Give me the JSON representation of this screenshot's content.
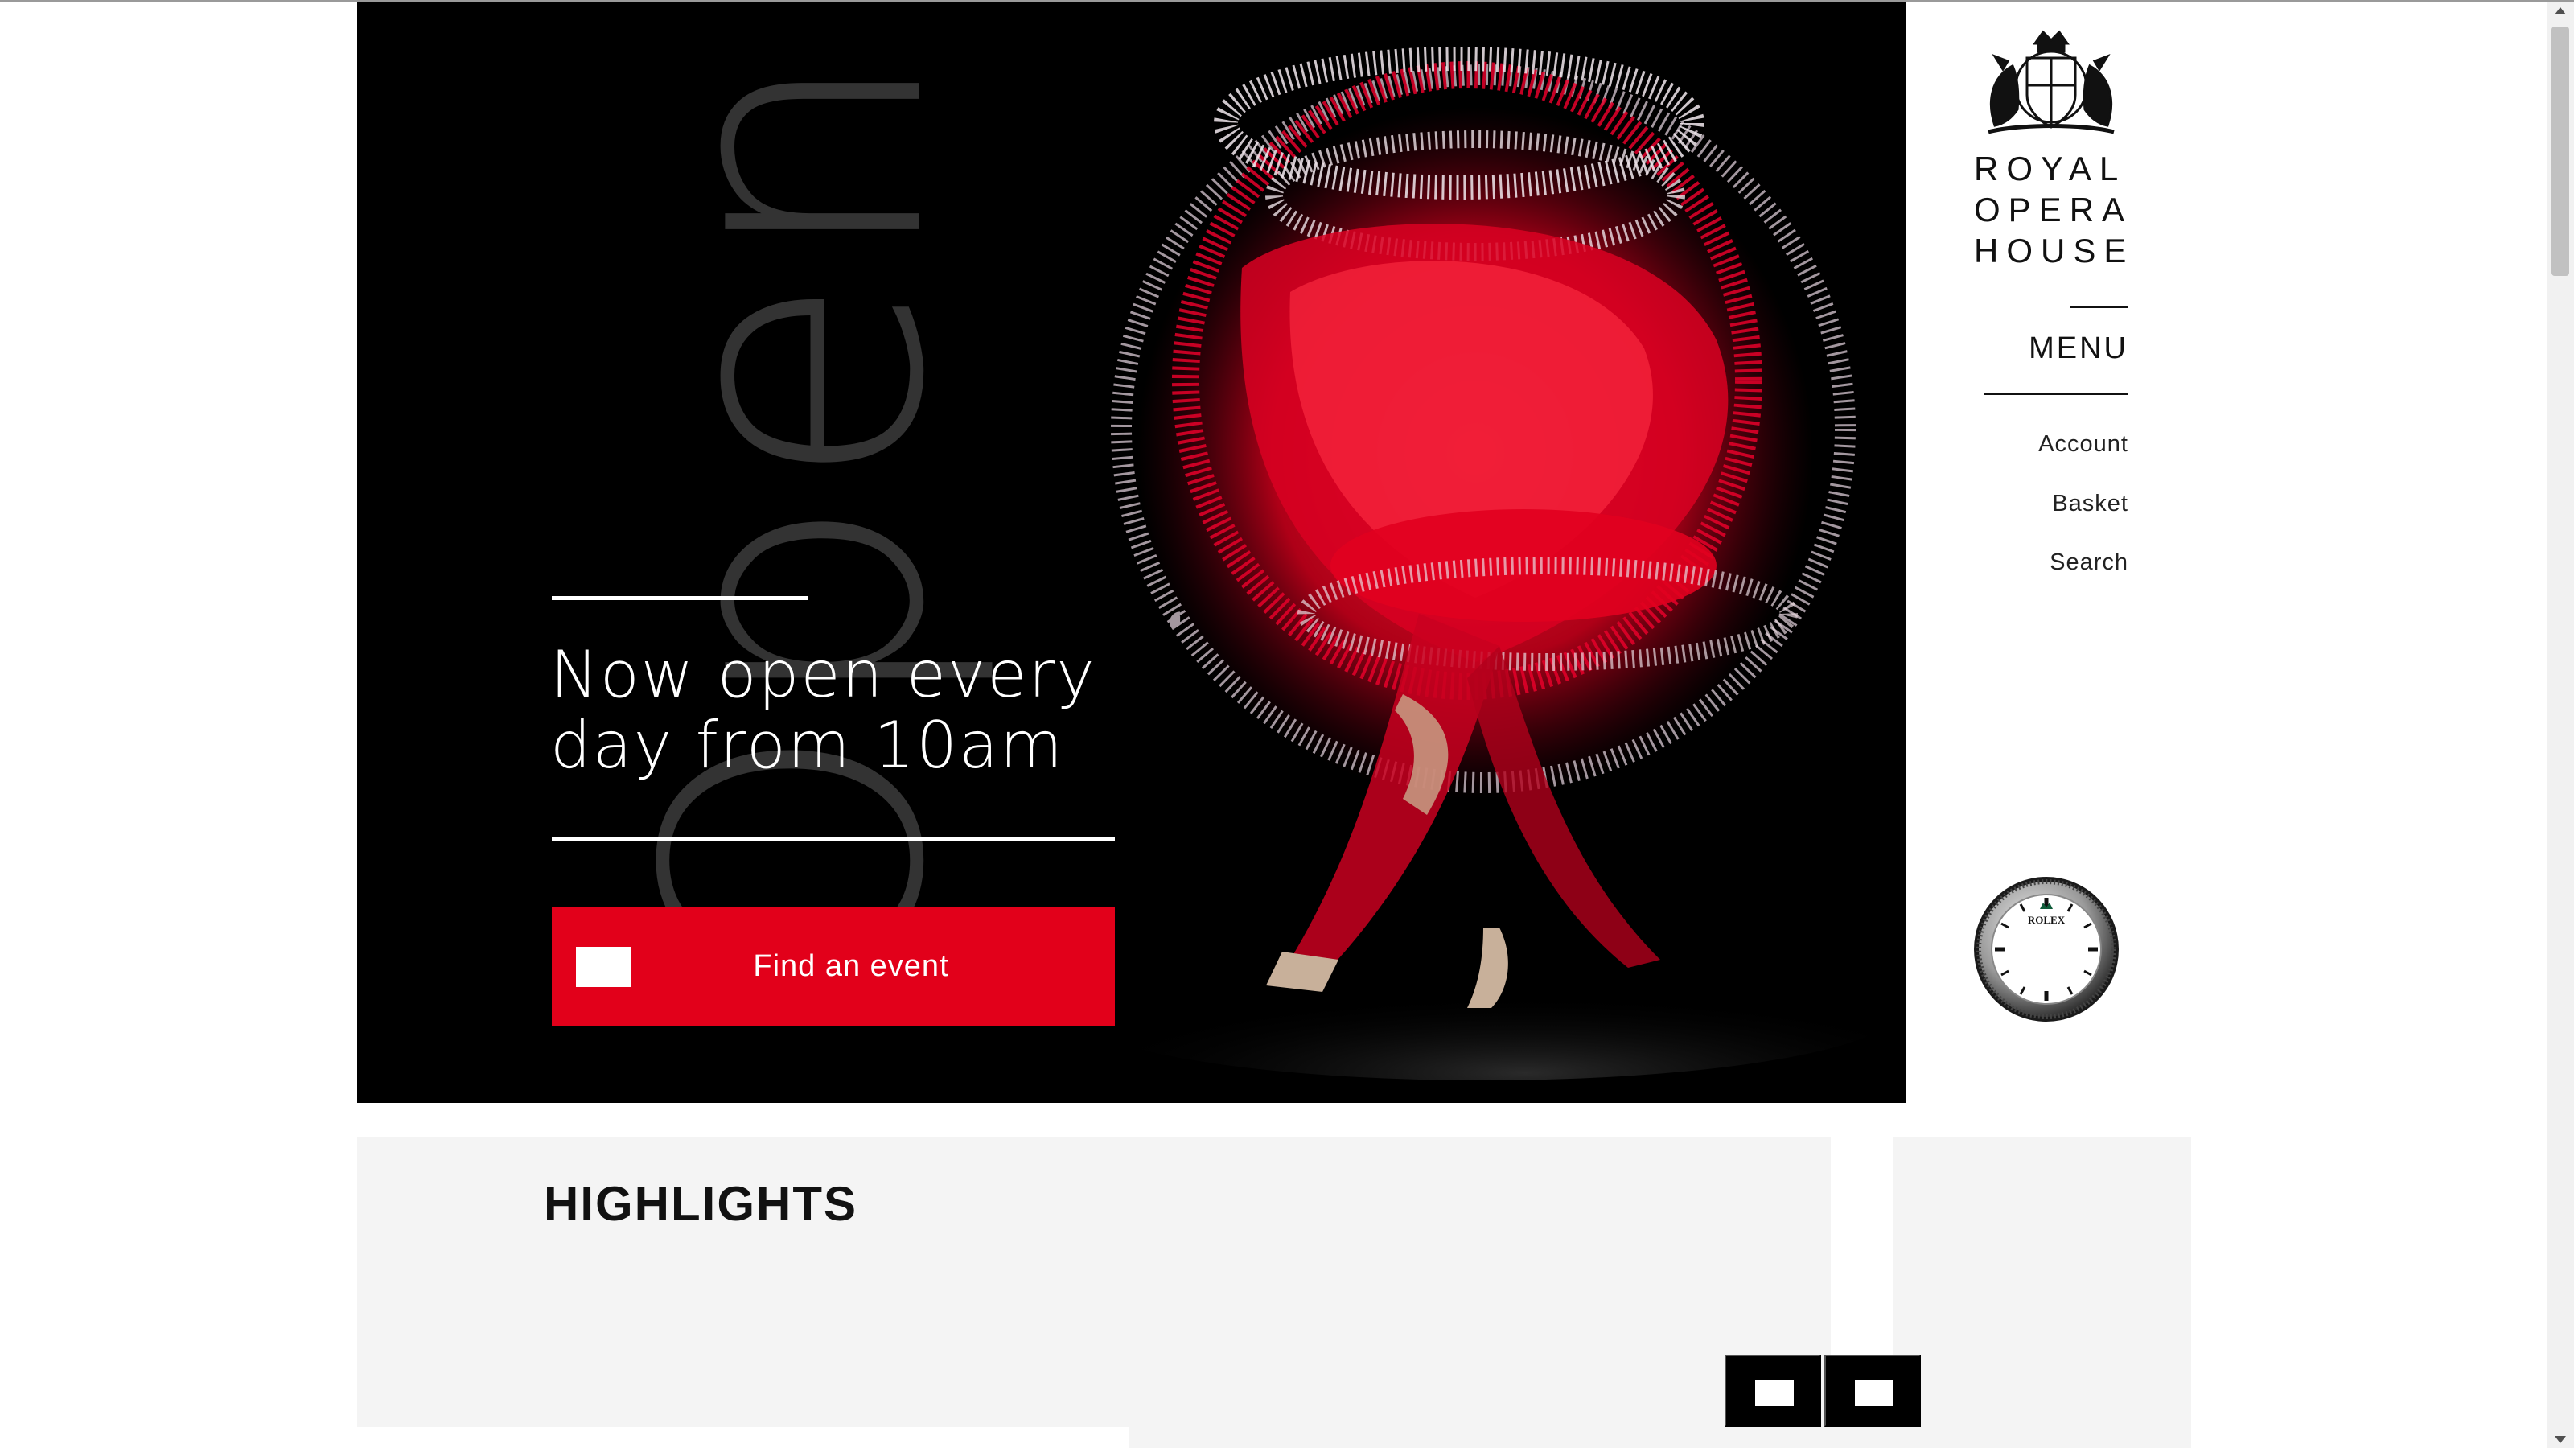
{
  "brand": {
    "name_line1": "ROYAL",
    "name_line2": "OPERA",
    "name_line3": "HOUSE",
    "sponsor": "ROLEX"
  },
  "hero": {
    "background_word": "Open",
    "heading": "Now open every day from 10am",
    "cta_label": "Find an event",
    "accent_color": "#e2001a"
  },
  "nav": {
    "menu_label": "MENU",
    "links": [
      "Account",
      "Basket",
      "Search"
    ]
  },
  "highlights": {
    "title": "HIGHLIGHTS"
  },
  "icons": {
    "cta": "ticket-icon",
    "prev": "arrow-left-icon",
    "next": "arrow-right-icon",
    "logo": "royal-crest-icon",
    "sponsor": "rolex-clock-icon"
  }
}
